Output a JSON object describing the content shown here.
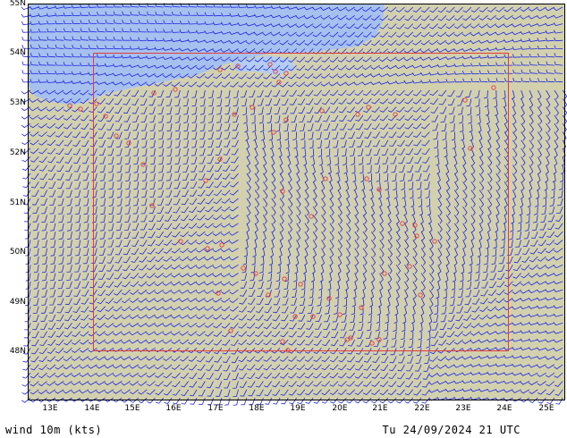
{
  "map": {
    "lon_labels": [
      "13E",
      "14E",
      "15E",
      "16E",
      "17E",
      "18E",
      "19E",
      "20E",
      "21E",
      "22E",
      "23E",
      "24E",
      "25E"
    ],
    "lat_labels": [
      "55N",
      "54N",
      "53N",
      "52N",
      "51N",
      "50N",
      "49N",
      "48N"
    ],
    "colors": {
      "land": "#d3d1ad",
      "sea": "#b4cdf0",
      "sea_deep": "#a7c1ee",
      "barb": "#1a24e6",
      "station": "#e43a3a",
      "border": "#e43a3a",
      "axis": "#000000"
    }
  },
  "footer": {
    "left": "wind 10m (kts)",
    "right": "Tu 24/09/2024 21 UTC"
  }
}
